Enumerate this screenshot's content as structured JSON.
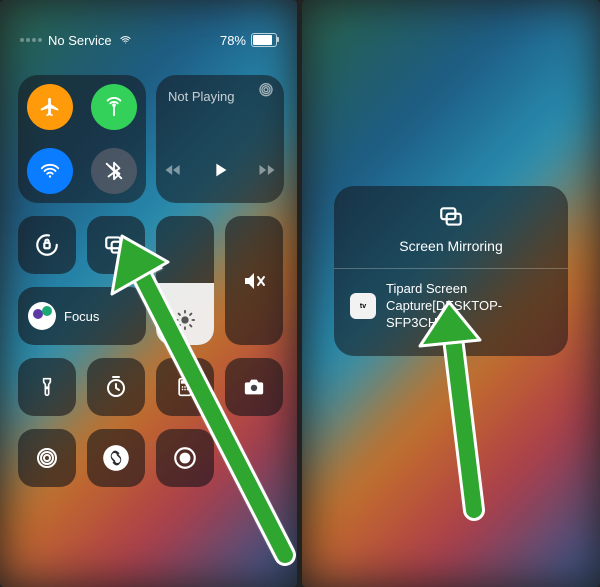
{
  "status": {
    "service": "No Service",
    "battery": "78%"
  },
  "connectivity": {
    "airplane": "airplane-icon",
    "cellular": "antenna-icon",
    "wifi": "wifi-icon",
    "bluetooth": "bluetooth-off-icon"
  },
  "media": {
    "title": "Not Playing"
  },
  "focus": {
    "label": "Focus"
  },
  "mirror": {
    "title": "Screen Mirroring",
    "device": "Tipard Screen Capture[DESKTOP-SFP3CHJ]",
    "device_badge": "tv"
  },
  "colors": {
    "arrow": "#2fa62f",
    "arrow_stroke": "#ffffff",
    "accent_blue": "#0a7cff",
    "accent_orange": "#ff9a0b",
    "accent_green": "#33d15a"
  }
}
